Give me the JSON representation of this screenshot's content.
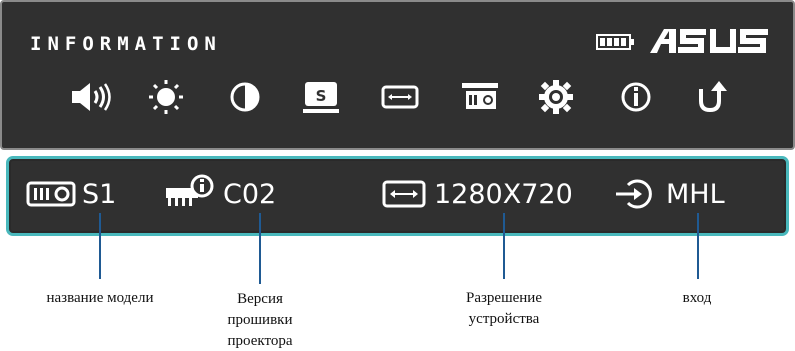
{
  "header": {
    "title": "INFORMATION",
    "brand": "ASUS",
    "battery_icon": "battery-full-icon"
  },
  "menu_icons": [
    "volume-icon",
    "brightness-icon",
    "contrast-icon",
    "source-icon",
    "aspect-ratio-icon",
    "projector-icon",
    "settings-gear-icon",
    "information-icon",
    "return-icon"
  ],
  "status": {
    "model": "S1",
    "firmware": "C02",
    "resolution": "1280X720",
    "input": "MHL"
  },
  "callouts": {
    "model": "название модели",
    "firmware": "Версия прошивки проектора",
    "resolution": "Разрешение устройства",
    "input": "вход"
  },
  "colors": {
    "panel": "#303030",
    "highlight_border": "#49b8bc",
    "callout_line": "#1f5a93"
  }
}
